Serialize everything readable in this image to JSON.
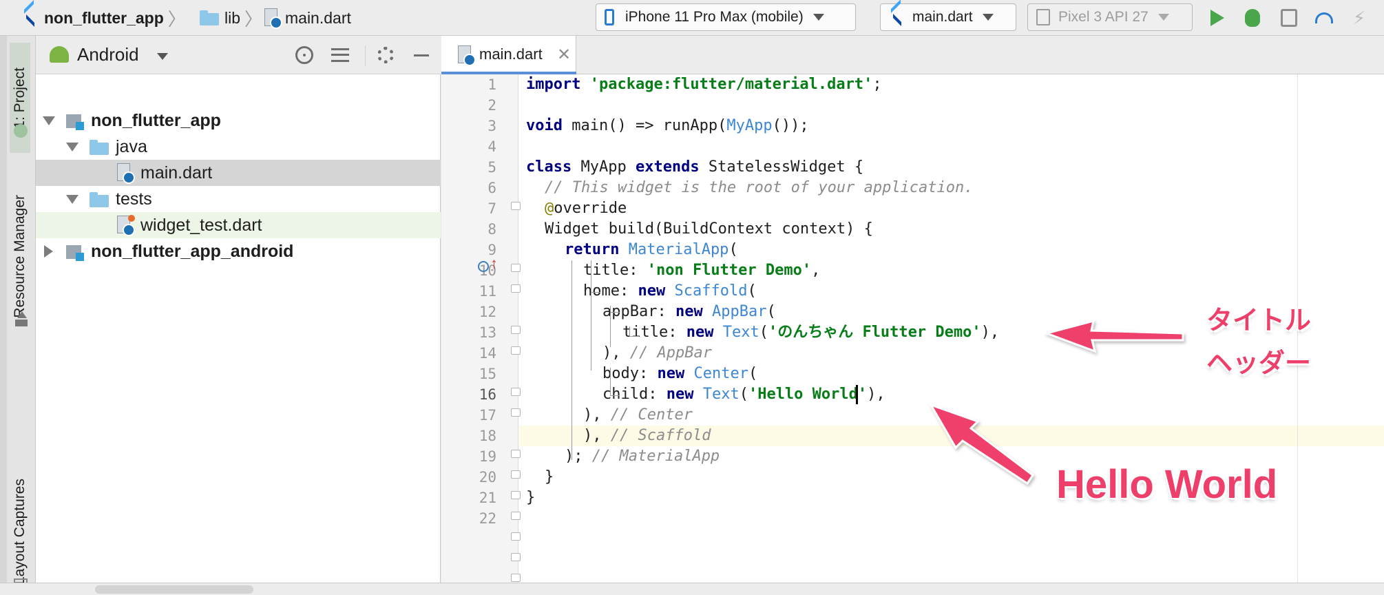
{
  "breadcrumb": {
    "project": "non_flutter_app",
    "folder": "lib",
    "file": "main.dart"
  },
  "toolbar": {
    "device_selector": "iPhone 11 Pro Max (mobile)",
    "config_selector": "main.dart",
    "emulator_selector": "Pixel 3 API 27",
    "icons": [
      "play-icon",
      "bug-icon",
      "profile-icon",
      "gauge-icon",
      "bolt-icon"
    ]
  },
  "tool_strip": {
    "project_tab": "1: Project",
    "resource_tab": "Resource Manager",
    "captures_tab": "Layout Captures"
  },
  "project_panel": {
    "view_label": "Android",
    "tree": [
      {
        "label": "non_flutter_app",
        "kind": "module",
        "expanded": true
      },
      {
        "label": "java",
        "kind": "folder",
        "expanded": true
      },
      {
        "label": "main.dart",
        "kind": "dart-file",
        "selected": true
      },
      {
        "label": "tests",
        "kind": "folder",
        "expanded": true
      },
      {
        "label": "widget_test.dart",
        "kind": "test-file"
      },
      {
        "label": "non_flutter_app_android",
        "kind": "module",
        "expanded": false
      }
    ]
  },
  "editor": {
    "tab_label": "main.dart",
    "current_line": 16,
    "line_numbers": [
      "1",
      "2",
      "3",
      "4",
      "5",
      "6",
      "7",
      "8",
      "9",
      "10",
      "11",
      "12",
      "13",
      "14",
      "15",
      "16",
      "17",
      "18",
      "19",
      "20",
      "21",
      "22"
    ],
    "code": {
      "l1_kw": "import",
      "l1_str": "'package:flutter/material.dart'",
      "l1_end": ";",
      "l3_kw": "void",
      "l3_a": " main() => runApp(",
      "l3_cls": "MyApp",
      "l3_b": "());",
      "l5_kw1": "class",
      "l5_a": " MyApp ",
      "l5_kw2": "extends",
      "l5_b": " StatelessWidget {",
      "l6_cmt": "// This widget is the root of your application.",
      "l7_ann": "@",
      "l7_a": "override",
      "l8_a": "Widget build(BuildContext context) {",
      "l9_kw": "return",
      "l9_sp": " ",
      "l9_cls": "MaterialApp",
      "l9_b": "(",
      "l10_a": "title: ",
      "l10_str": "'non Flutter Demo'",
      "l10_b": ",",
      "l11_a": "home: ",
      "l11_kw": "new",
      "l11_sp": " ",
      "l11_cls": "Scaffold",
      "l11_b": "(",
      "l12_a": "appBar: ",
      "l12_kw": "new",
      "l12_sp": " ",
      "l12_cls": "AppBar",
      "l12_b": "(",
      "l13_a": "title: ",
      "l13_kw": "new",
      "l13_sp": " ",
      "l13_cls": "Text",
      "l13_b": "(",
      "l13_str": "'のんちゃん Flutter Demo'",
      "l13_c": "),",
      "l14_a": "), ",
      "l14_cmt": "// AppBar",
      "l15_a": "body: ",
      "l15_kw": "new",
      "l15_sp": " ",
      "l15_cls": "Center",
      "l15_b": "(",
      "l16_a": "child: ",
      "l16_kw": "new",
      "l16_sp": " ",
      "l16_cls": "Text",
      "l16_b": "(",
      "l16_str": "'Hello World'",
      "l16_c": "),",
      "l17_a": "), ",
      "l17_cmt": "// Center",
      "l18_a": "), ",
      "l18_cmt": "// Scaffold",
      "l19_a": "); ",
      "l19_cmt": "// MaterialApp",
      "l20_a": "}",
      "l21_a": "}"
    }
  },
  "annotations": {
    "title_line1": "タイトル",
    "title_line2": "ヘッダー",
    "hello": "Hello World",
    "color": "#ee3f6a"
  }
}
